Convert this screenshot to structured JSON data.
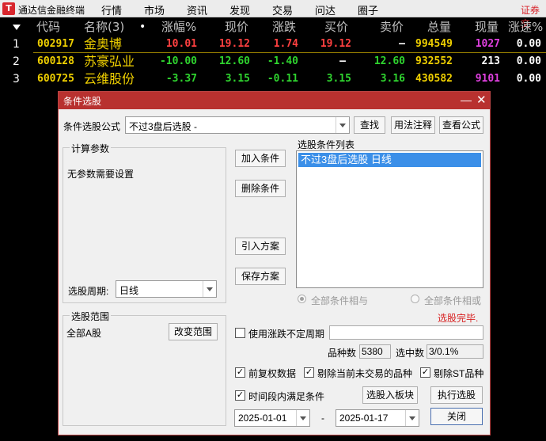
{
  "app": {
    "title": "通达信金融终端",
    "menu": [
      "行情",
      "市场",
      "资讯",
      "发现",
      "交易",
      "问达",
      "圈子"
    ],
    "extra": "证券交"
  },
  "quote": {
    "headers": [
      "代码",
      "名称(3)",
      "•",
      "涨幅%",
      "现价",
      "涨跌",
      "买价",
      "卖价",
      "总量",
      "现量",
      "涨速%"
    ],
    "rows": [
      {
        "idx": "1",
        "code": "002917",
        "name": "金奥博",
        "pct": "10.01",
        "price": "19.12",
        "chg": "1.74",
        "bid": "19.12",
        "ask": "—",
        "vol": "994549",
        "cur": "1027",
        "speed": "0.00"
      },
      {
        "idx": "2",
        "code": "600128",
        "name": "苏豪弘业",
        "pct": "-10.00",
        "price": "12.60",
        "chg": "-1.40",
        "bid": "—",
        "ask": "12.60",
        "vol": "932552",
        "cur": "213",
        "speed": "0.00"
      },
      {
        "idx": "3",
        "code": "600725",
        "name": "云维股份",
        "pct": "-3.37",
        "price": "3.15",
        "chg": "-0.11",
        "bid": "3.15",
        "ask": "3.16",
        "vol": "430582",
        "cur": "9101",
        "speed": "0.00"
      }
    ]
  },
  "dialog": {
    "title": "条件选股",
    "formula_label": "条件选股公式",
    "formula_value": "不过3盘后选股 -",
    "btn_find": "查找",
    "btn_usage": "用法注释",
    "btn_view": "查看公式",
    "params_title": "计算参数",
    "params_text": "无参数需要设置",
    "period_label": "选股周期:",
    "period_value": "日线",
    "btn_add": "加入条件",
    "btn_delete": "删除条件",
    "btn_import": "引入方案",
    "btn_save": "保存方案",
    "list_title": "选股条件列表",
    "list_item": "不过3盘后选股  日线",
    "radio_and": "全部条件相与",
    "radio_or": "全部条件相或",
    "status": "选股完毕.",
    "range_title": "选股范围",
    "range_value": "全部A股",
    "btn_range": "改变范围",
    "use_period": "使用涨跌不定周期",
    "count_label": "品种数",
    "count_value": "5380",
    "hit_label": "选中数",
    "hit_value": "3/0.1%",
    "cb_fq": "前复权数据",
    "cb_remove_untraded": "剔除当前未交易的品种",
    "cb_remove_st": "剔除ST品种",
    "cb_time": "时间段内满足条件",
    "btn_to_block": "选股入板块",
    "btn_execute": "执行选股",
    "date_from": "2025-01-01",
    "date_sep": "-",
    "date_to": "2025-01-17",
    "btn_close": "关闭"
  },
  "colors": {
    "up": "#ff4040",
    "down": "#2fd42f",
    "accent": "#b8312f",
    "select": "#3b8fe8"
  }
}
